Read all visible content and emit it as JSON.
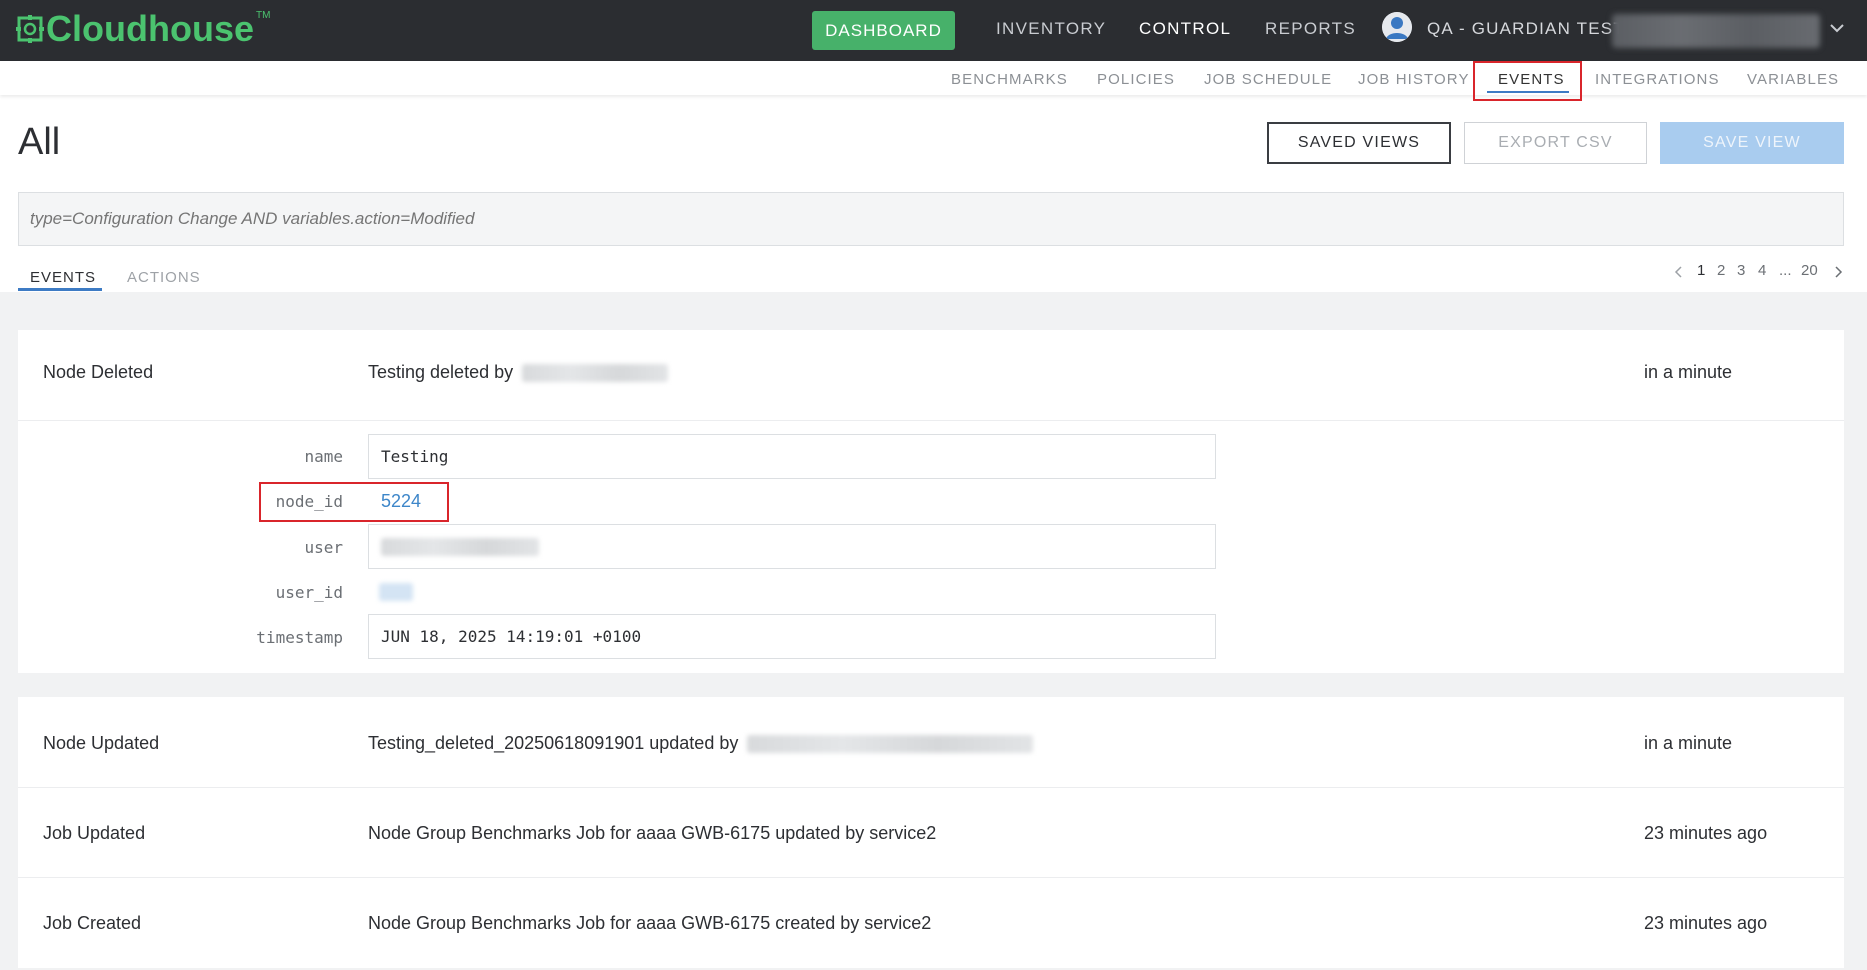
{
  "app": {
    "logo_text": "Cloudhouse",
    "logo_tm": "TM",
    "brand_color": "#4bc36f"
  },
  "topnav": {
    "dashboard_label": "DASHBOARD",
    "items": [
      {
        "label": "INVENTORY",
        "active": false
      },
      {
        "label": "CONTROL",
        "active": true
      },
      {
        "label": "REPORTS",
        "active": false
      }
    ],
    "user_name": "QA - GUARDIAN TEST"
  },
  "subnav": {
    "items": [
      {
        "label": "BENCHMARKS"
      },
      {
        "label": "POLICIES"
      },
      {
        "label": "JOB SCHEDULE"
      },
      {
        "label": "JOB HISTORY"
      },
      {
        "label": "EVENTS",
        "active": true
      },
      {
        "label": "INTEGRATIONS"
      },
      {
        "label": "VARIABLES"
      }
    ]
  },
  "page": {
    "title": "All",
    "saved_views_label": "SAVED VIEWS",
    "export_csv_label": "EXPORT CSV",
    "save_view_label": "SAVE VIEW",
    "filter_placeholder": "type=Configuration Change AND variables.action=Modified"
  },
  "tabs": {
    "events": "EVENTS",
    "actions": "ACTIONS"
  },
  "pagination": {
    "pages": [
      "1",
      "2",
      "3",
      "4",
      "...",
      "20"
    ],
    "current": "1"
  },
  "events": [
    {
      "type": "Node Deleted",
      "desc": "Testing deleted by",
      "time": "in a minute"
    },
    {
      "type": "Node Updated",
      "desc": "Testing_deleted_20250618091901 updated by",
      "time": "in a minute"
    },
    {
      "type": "Job Updated",
      "desc": "Node Group Benchmarks Job for aaaa GWB-6175 updated by service2",
      "time": "23 minutes ago"
    },
    {
      "type": "Job Created",
      "desc": "Node Group Benchmarks Job for aaaa GWB-6175 created by service2",
      "time": "23 minutes ago"
    }
  ],
  "details": {
    "name_label": "name",
    "name_value": "Testing",
    "node_id_label": "node_id",
    "node_id_value": "5224",
    "user_label": "user",
    "user_id_label": "user_id",
    "timestamp_label": "timestamp",
    "timestamp_value": "JUN 18, 2025 14:19:01 +0100"
  }
}
